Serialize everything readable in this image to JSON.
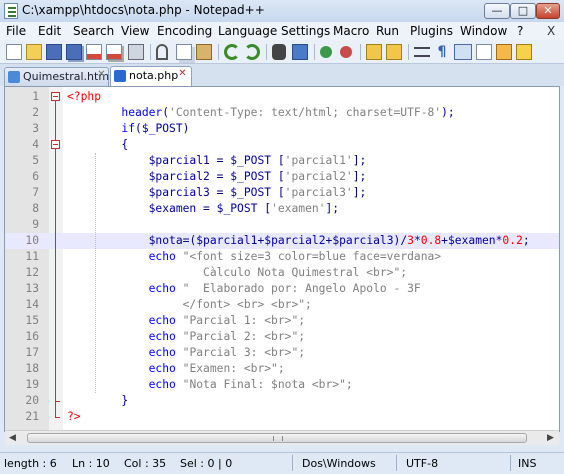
{
  "window": {
    "title": "C:\\xampp\\htdocs\\nota.php - Notepad++",
    "min_glyph": "—",
    "max_glyph": "□",
    "close_glyph": "✕"
  },
  "menu": [
    "File",
    "Edit",
    "Search",
    "View",
    "Encoding",
    "Language",
    "Settings",
    "Macro",
    "Run",
    "Plugins",
    "Window",
    "?"
  ],
  "menu_close": "X",
  "toolbar": [
    "new-file-icon",
    "open-file-icon",
    "save-icon",
    "save-all-icon",
    "close-icon",
    "close-all-icon",
    "print-icon",
    "cut-icon",
    "copy-icon",
    "paste-icon",
    "undo-icon",
    "redo-icon",
    "find-icon",
    "replace-icon",
    "zoom-in-icon",
    "zoom-out-icon",
    "sync-v-icon",
    "sync-h-icon",
    "wrap-icon",
    "all-chars-icon",
    "indent-guide-icon",
    "doc-map-icon",
    "record-macro-icon"
  ],
  "tabs": [
    {
      "label": "Quimestral.html",
      "active": false
    },
    {
      "label": "nota.php",
      "active": true
    }
  ],
  "editor": {
    "current_line": 10,
    "lines": [
      {
        "n": "1",
        "tokens": [
          [
            "t",
            "<?php"
          ]
        ]
      },
      {
        "n": "2",
        "tokens": [
          [
            "",
            "        "
          ],
          [
            "k",
            "header"
          ],
          [
            "p",
            "("
          ],
          [
            "s",
            "'Content-Type: text/html; charset=UTF-8'"
          ],
          [
            "p",
            ");"
          ]
        ]
      },
      {
        "n": "3",
        "tokens": [
          [
            "",
            "        "
          ],
          [
            "k",
            "if"
          ],
          [
            "p",
            "("
          ],
          [
            "v",
            "$_POST"
          ],
          [
            "p",
            ")"
          ]
        ]
      },
      {
        "n": "4",
        "tokens": [
          [
            "",
            "        "
          ],
          [
            "p",
            "{"
          ]
        ]
      },
      {
        "n": "5",
        "tokens": [
          [
            "",
            "            "
          ],
          [
            "v",
            "$parcial1"
          ],
          [
            "p",
            " = "
          ],
          [
            "v",
            "$_POST"
          ],
          [
            "p",
            " ["
          ],
          [
            "s",
            "'parcial1'"
          ],
          [
            "p",
            "];"
          ]
        ]
      },
      {
        "n": "6",
        "tokens": [
          [
            "",
            "            "
          ],
          [
            "v",
            "$parcial2"
          ],
          [
            "p",
            " = "
          ],
          [
            "v",
            "$_POST"
          ],
          [
            "p",
            " ["
          ],
          [
            "s",
            "'parcial2'"
          ],
          [
            "p",
            "];"
          ]
        ]
      },
      {
        "n": "7",
        "tokens": [
          [
            "",
            "            "
          ],
          [
            "v",
            "$parcial3"
          ],
          [
            "p",
            " = "
          ],
          [
            "v",
            "$_POST"
          ],
          [
            "p",
            " ["
          ],
          [
            "s",
            "'parcial3'"
          ],
          [
            "p",
            "];"
          ]
        ]
      },
      {
        "n": "8",
        "tokens": [
          [
            "",
            "            "
          ],
          [
            "v",
            "$examen"
          ],
          [
            "p",
            " = "
          ],
          [
            "v",
            "$_POST"
          ],
          [
            "p",
            " ["
          ],
          [
            "s",
            "'examen'"
          ],
          [
            "p",
            "];"
          ]
        ]
      },
      {
        "n": "9",
        "tokens": []
      },
      {
        "n": "10",
        "tokens": [
          [
            "",
            "            "
          ],
          [
            "v",
            "$nota"
          ],
          [
            "p",
            "=("
          ],
          [
            "v",
            "$parcial1"
          ],
          [
            "p",
            "+"
          ],
          [
            "v",
            "$parcial2"
          ],
          [
            "p",
            "+"
          ],
          [
            "v",
            "$parcial3"
          ],
          [
            "p",
            ")/"
          ],
          [
            "n",
            "3"
          ],
          [
            "p",
            "*"
          ],
          [
            "n",
            "0.8"
          ],
          [
            "p",
            "+"
          ],
          [
            "v",
            "$examen"
          ],
          [
            "p",
            "*"
          ],
          [
            "n",
            "0.2"
          ],
          [
            "p",
            ";"
          ]
        ]
      },
      {
        "n": "11",
        "tokens": [
          [
            "",
            "            "
          ],
          [
            "k",
            "echo"
          ],
          [
            "s",
            " \"<font size=3 color=blue face=verdana>"
          ]
        ]
      },
      {
        "n": "12",
        "tokens": [
          [
            "s",
            "                    Càlculo Nota Quimestral <br>\";"
          ]
        ]
      },
      {
        "n": "13",
        "tokens": [
          [
            "",
            "            "
          ],
          [
            "k",
            "echo"
          ],
          [
            "s",
            " \"  Elaborado por: Angelo Apolo - 3F"
          ]
        ]
      },
      {
        "n": "14",
        "tokens": [
          [
            "s",
            "                 </font> <br> <br>\";"
          ]
        ]
      },
      {
        "n": "15",
        "tokens": [
          [
            "",
            "            "
          ],
          [
            "k",
            "echo"
          ],
          [
            "s",
            " \"Parcial 1: <br>\";"
          ]
        ]
      },
      {
        "n": "16",
        "tokens": [
          [
            "",
            "            "
          ],
          [
            "k",
            "echo"
          ],
          [
            "s",
            " \"Parcial 2: <br>\";"
          ]
        ]
      },
      {
        "n": "17",
        "tokens": [
          [
            "",
            "            "
          ],
          [
            "k",
            "echo"
          ],
          [
            "s",
            " \"Parcial 3: <br>\";"
          ]
        ]
      },
      {
        "n": "18",
        "tokens": [
          [
            "",
            "            "
          ],
          [
            "k",
            "echo"
          ],
          [
            "s",
            " \"Examen: <br>\";"
          ]
        ]
      },
      {
        "n": "19",
        "tokens": [
          [
            "",
            "            "
          ],
          [
            "k",
            "echo"
          ],
          [
            "s",
            " \"Nota Final: $nota <br>\";"
          ]
        ]
      },
      {
        "n": "20",
        "tokens": [
          [
            "",
            "        "
          ],
          [
            "p",
            "}"
          ]
        ]
      },
      {
        "n": "21",
        "tokens": [
          [
            "t",
            "?>"
          ]
        ]
      }
    ]
  },
  "statusbar": {
    "length": "length : 6",
    "ln": "Ln : 10",
    "col": "Col : 35",
    "sel": "Sel : 0 | 0",
    "eol": "Dos\\Windows",
    "encoding": "UTF-8",
    "mode": "INS"
  },
  "colors": {
    "keyword": "#0000ff",
    "variable": "#0000a0",
    "string": "#808080",
    "number": "#ff0000",
    "php_tag": "#ff0000",
    "current_line": "#e8e8ff"
  }
}
